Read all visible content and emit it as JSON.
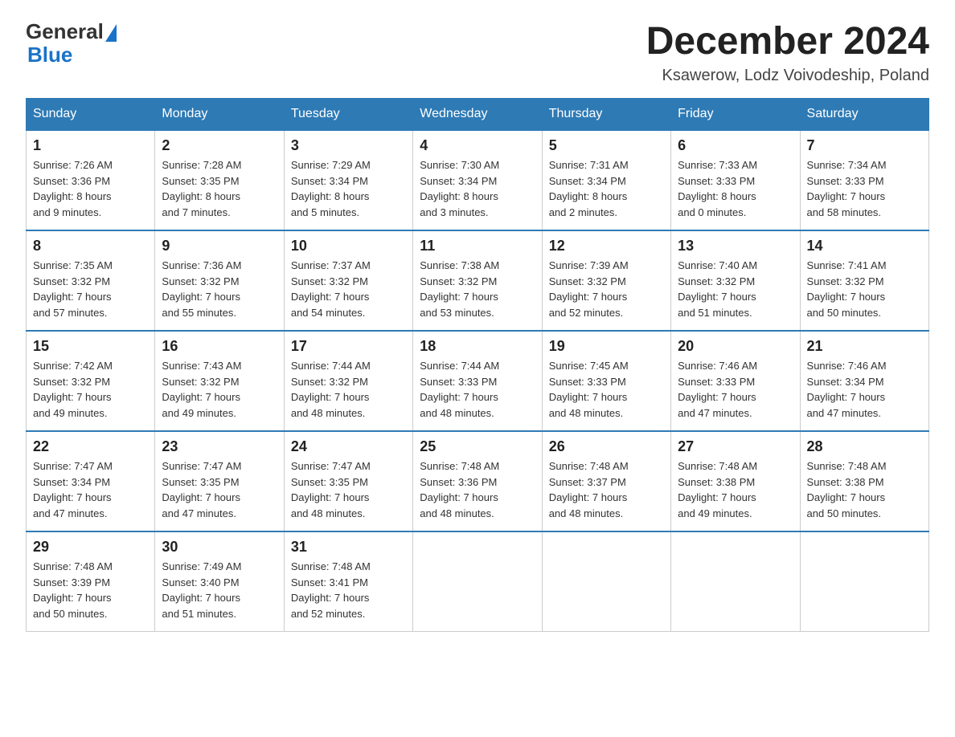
{
  "header": {
    "logo": {
      "general_text": "General",
      "triangle": "▶",
      "blue_text": "Blue"
    },
    "title": "December 2024",
    "subtitle": "Ksawerow, Lodz Voivodeship, Poland"
  },
  "days_of_week": [
    "Sunday",
    "Monday",
    "Tuesday",
    "Wednesday",
    "Thursday",
    "Friday",
    "Saturday"
  ],
  "weeks": [
    [
      {
        "day": "1",
        "sunrise": "7:26 AM",
        "sunset": "3:36 PM",
        "daylight": "8 hours and 9 minutes."
      },
      {
        "day": "2",
        "sunrise": "7:28 AM",
        "sunset": "3:35 PM",
        "daylight": "8 hours and 7 minutes."
      },
      {
        "day": "3",
        "sunrise": "7:29 AM",
        "sunset": "3:34 PM",
        "daylight": "8 hours and 5 minutes."
      },
      {
        "day": "4",
        "sunrise": "7:30 AM",
        "sunset": "3:34 PM",
        "daylight": "8 hours and 3 minutes."
      },
      {
        "day": "5",
        "sunrise": "7:31 AM",
        "sunset": "3:34 PM",
        "daylight": "8 hours and 2 minutes."
      },
      {
        "day": "6",
        "sunrise": "7:33 AM",
        "sunset": "3:33 PM",
        "daylight": "8 hours and 0 minutes."
      },
      {
        "day": "7",
        "sunrise": "7:34 AM",
        "sunset": "3:33 PM",
        "daylight": "7 hours and 58 minutes."
      }
    ],
    [
      {
        "day": "8",
        "sunrise": "7:35 AM",
        "sunset": "3:32 PM",
        "daylight": "7 hours and 57 minutes."
      },
      {
        "day": "9",
        "sunrise": "7:36 AM",
        "sunset": "3:32 PM",
        "daylight": "7 hours and 55 minutes."
      },
      {
        "day": "10",
        "sunrise": "7:37 AM",
        "sunset": "3:32 PM",
        "daylight": "7 hours and 54 minutes."
      },
      {
        "day": "11",
        "sunrise": "7:38 AM",
        "sunset": "3:32 PM",
        "daylight": "7 hours and 53 minutes."
      },
      {
        "day": "12",
        "sunrise": "7:39 AM",
        "sunset": "3:32 PM",
        "daylight": "7 hours and 52 minutes."
      },
      {
        "day": "13",
        "sunrise": "7:40 AM",
        "sunset": "3:32 PM",
        "daylight": "7 hours and 51 minutes."
      },
      {
        "day": "14",
        "sunrise": "7:41 AM",
        "sunset": "3:32 PM",
        "daylight": "7 hours and 50 minutes."
      }
    ],
    [
      {
        "day": "15",
        "sunrise": "7:42 AM",
        "sunset": "3:32 PM",
        "daylight": "7 hours and 49 minutes."
      },
      {
        "day": "16",
        "sunrise": "7:43 AM",
        "sunset": "3:32 PM",
        "daylight": "7 hours and 49 minutes."
      },
      {
        "day": "17",
        "sunrise": "7:44 AM",
        "sunset": "3:32 PM",
        "daylight": "7 hours and 48 minutes."
      },
      {
        "day": "18",
        "sunrise": "7:44 AM",
        "sunset": "3:33 PM",
        "daylight": "7 hours and 48 minutes."
      },
      {
        "day": "19",
        "sunrise": "7:45 AM",
        "sunset": "3:33 PM",
        "daylight": "7 hours and 48 minutes."
      },
      {
        "day": "20",
        "sunrise": "7:46 AM",
        "sunset": "3:33 PM",
        "daylight": "7 hours and 47 minutes."
      },
      {
        "day": "21",
        "sunrise": "7:46 AM",
        "sunset": "3:34 PM",
        "daylight": "7 hours and 47 minutes."
      }
    ],
    [
      {
        "day": "22",
        "sunrise": "7:47 AM",
        "sunset": "3:34 PM",
        "daylight": "7 hours and 47 minutes."
      },
      {
        "day": "23",
        "sunrise": "7:47 AM",
        "sunset": "3:35 PM",
        "daylight": "7 hours and 47 minutes."
      },
      {
        "day": "24",
        "sunrise": "7:47 AM",
        "sunset": "3:35 PM",
        "daylight": "7 hours and 48 minutes."
      },
      {
        "day": "25",
        "sunrise": "7:48 AM",
        "sunset": "3:36 PM",
        "daylight": "7 hours and 48 minutes."
      },
      {
        "day": "26",
        "sunrise": "7:48 AM",
        "sunset": "3:37 PM",
        "daylight": "7 hours and 48 minutes."
      },
      {
        "day": "27",
        "sunrise": "7:48 AM",
        "sunset": "3:38 PM",
        "daylight": "7 hours and 49 minutes."
      },
      {
        "day": "28",
        "sunrise": "7:48 AM",
        "sunset": "3:38 PM",
        "daylight": "7 hours and 50 minutes."
      }
    ],
    [
      {
        "day": "29",
        "sunrise": "7:48 AM",
        "sunset": "3:39 PM",
        "daylight": "7 hours and 50 minutes."
      },
      {
        "day": "30",
        "sunrise": "7:49 AM",
        "sunset": "3:40 PM",
        "daylight": "7 hours and 51 minutes."
      },
      {
        "day": "31",
        "sunrise": "7:48 AM",
        "sunset": "3:41 PM",
        "daylight": "7 hours and 52 minutes."
      },
      null,
      null,
      null,
      null
    ]
  ],
  "labels": {
    "sunrise": "Sunrise:",
    "sunset": "Sunset:",
    "daylight": "Daylight:"
  }
}
